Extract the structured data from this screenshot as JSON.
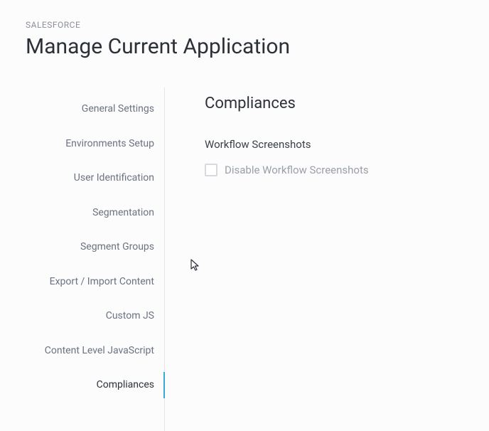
{
  "breadcrumb": "SALESFORCE",
  "page_title": "Manage Current Application",
  "sidebar": {
    "items": [
      {
        "label": "General Settings"
      },
      {
        "label": "Environments Setup"
      },
      {
        "label": "User Identification"
      },
      {
        "label": "Segmentation"
      },
      {
        "label": "Segment Groups"
      },
      {
        "label": "Export / Import Content"
      },
      {
        "label": "Custom JS"
      },
      {
        "label": "Content Level JavaScript"
      },
      {
        "label": "Compliances"
      }
    ],
    "active_index": 8
  },
  "main": {
    "title": "Compliances",
    "subsection_title": "Workflow Screenshots",
    "checkbox_label": "Disable Workflow Screenshots",
    "checkbox_checked": false
  }
}
